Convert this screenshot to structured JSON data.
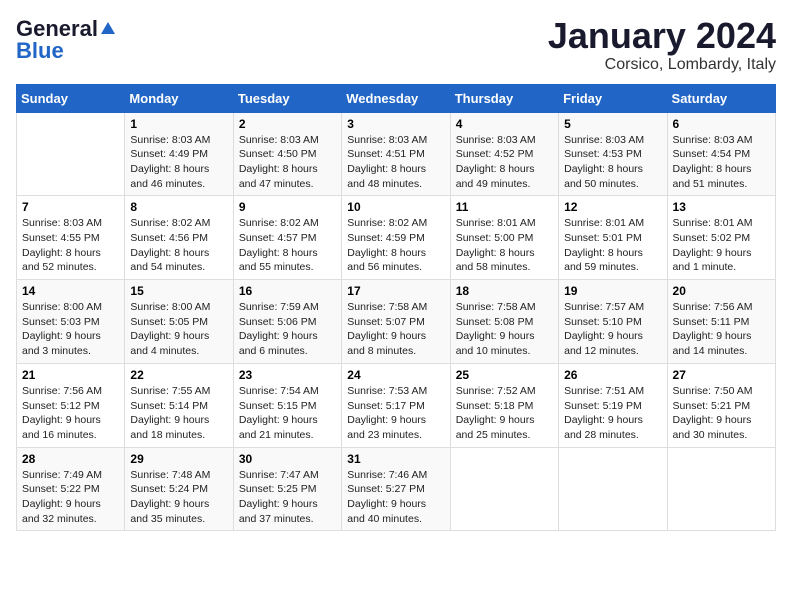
{
  "header": {
    "logo_general": "General",
    "logo_blue": "Blue",
    "month_title": "January 2024",
    "location": "Corsico, Lombardy, Italy"
  },
  "weekdays": [
    "Sunday",
    "Monday",
    "Tuesday",
    "Wednesday",
    "Thursday",
    "Friday",
    "Saturday"
  ],
  "weeks": [
    [
      {
        "day": "",
        "info": ""
      },
      {
        "day": "1",
        "info": "Sunrise: 8:03 AM\nSunset: 4:49 PM\nDaylight: 8 hours\nand 46 minutes."
      },
      {
        "day": "2",
        "info": "Sunrise: 8:03 AM\nSunset: 4:50 PM\nDaylight: 8 hours\nand 47 minutes."
      },
      {
        "day": "3",
        "info": "Sunrise: 8:03 AM\nSunset: 4:51 PM\nDaylight: 8 hours\nand 48 minutes."
      },
      {
        "day": "4",
        "info": "Sunrise: 8:03 AM\nSunset: 4:52 PM\nDaylight: 8 hours\nand 49 minutes."
      },
      {
        "day": "5",
        "info": "Sunrise: 8:03 AM\nSunset: 4:53 PM\nDaylight: 8 hours\nand 50 minutes."
      },
      {
        "day": "6",
        "info": "Sunrise: 8:03 AM\nSunset: 4:54 PM\nDaylight: 8 hours\nand 51 minutes."
      }
    ],
    [
      {
        "day": "7",
        "info": "Sunrise: 8:03 AM\nSunset: 4:55 PM\nDaylight: 8 hours\nand 52 minutes."
      },
      {
        "day": "8",
        "info": "Sunrise: 8:02 AM\nSunset: 4:56 PM\nDaylight: 8 hours\nand 54 minutes."
      },
      {
        "day": "9",
        "info": "Sunrise: 8:02 AM\nSunset: 4:57 PM\nDaylight: 8 hours\nand 55 minutes."
      },
      {
        "day": "10",
        "info": "Sunrise: 8:02 AM\nSunset: 4:59 PM\nDaylight: 8 hours\nand 56 minutes."
      },
      {
        "day": "11",
        "info": "Sunrise: 8:01 AM\nSunset: 5:00 PM\nDaylight: 8 hours\nand 58 minutes."
      },
      {
        "day": "12",
        "info": "Sunrise: 8:01 AM\nSunset: 5:01 PM\nDaylight: 8 hours\nand 59 minutes."
      },
      {
        "day": "13",
        "info": "Sunrise: 8:01 AM\nSunset: 5:02 PM\nDaylight: 9 hours\nand 1 minute."
      }
    ],
    [
      {
        "day": "14",
        "info": "Sunrise: 8:00 AM\nSunset: 5:03 PM\nDaylight: 9 hours\nand 3 minutes."
      },
      {
        "day": "15",
        "info": "Sunrise: 8:00 AM\nSunset: 5:05 PM\nDaylight: 9 hours\nand 4 minutes."
      },
      {
        "day": "16",
        "info": "Sunrise: 7:59 AM\nSunset: 5:06 PM\nDaylight: 9 hours\nand 6 minutes."
      },
      {
        "day": "17",
        "info": "Sunrise: 7:58 AM\nSunset: 5:07 PM\nDaylight: 9 hours\nand 8 minutes."
      },
      {
        "day": "18",
        "info": "Sunrise: 7:58 AM\nSunset: 5:08 PM\nDaylight: 9 hours\nand 10 minutes."
      },
      {
        "day": "19",
        "info": "Sunrise: 7:57 AM\nSunset: 5:10 PM\nDaylight: 9 hours\nand 12 minutes."
      },
      {
        "day": "20",
        "info": "Sunrise: 7:56 AM\nSunset: 5:11 PM\nDaylight: 9 hours\nand 14 minutes."
      }
    ],
    [
      {
        "day": "21",
        "info": "Sunrise: 7:56 AM\nSunset: 5:12 PM\nDaylight: 9 hours\nand 16 minutes."
      },
      {
        "day": "22",
        "info": "Sunrise: 7:55 AM\nSunset: 5:14 PM\nDaylight: 9 hours\nand 18 minutes."
      },
      {
        "day": "23",
        "info": "Sunrise: 7:54 AM\nSunset: 5:15 PM\nDaylight: 9 hours\nand 21 minutes."
      },
      {
        "day": "24",
        "info": "Sunrise: 7:53 AM\nSunset: 5:17 PM\nDaylight: 9 hours\nand 23 minutes."
      },
      {
        "day": "25",
        "info": "Sunrise: 7:52 AM\nSunset: 5:18 PM\nDaylight: 9 hours\nand 25 minutes."
      },
      {
        "day": "26",
        "info": "Sunrise: 7:51 AM\nSunset: 5:19 PM\nDaylight: 9 hours\nand 28 minutes."
      },
      {
        "day": "27",
        "info": "Sunrise: 7:50 AM\nSunset: 5:21 PM\nDaylight: 9 hours\nand 30 minutes."
      }
    ],
    [
      {
        "day": "28",
        "info": "Sunrise: 7:49 AM\nSunset: 5:22 PM\nDaylight: 9 hours\nand 32 minutes."
      },
      {
        "day": "29",
        "info": "Sunrise: 7:48 AM\nSunset: 5:24 PM\nDaylight: 9 hours\nand 35 minutes."
      },
      {
        "day": "30",
        "info": "Sunrise: 7:47 AM\nSunset: 5:25 PM\nDaylight: 9 hours\nand 37 minutes."
      },
      {
        "day": "31",
        "info": "Sunrise: 7:46 AM\nSunset: 5:27 PM\nDaylight: 9 hours\nand 40 minutes."
      },
      {
        "day": "",
        "info": ""
      },
      {
        "day": "",
        "info": ""
      },
      {
        "day": "",
        "info": ""
      }
    ]
  ]
}
